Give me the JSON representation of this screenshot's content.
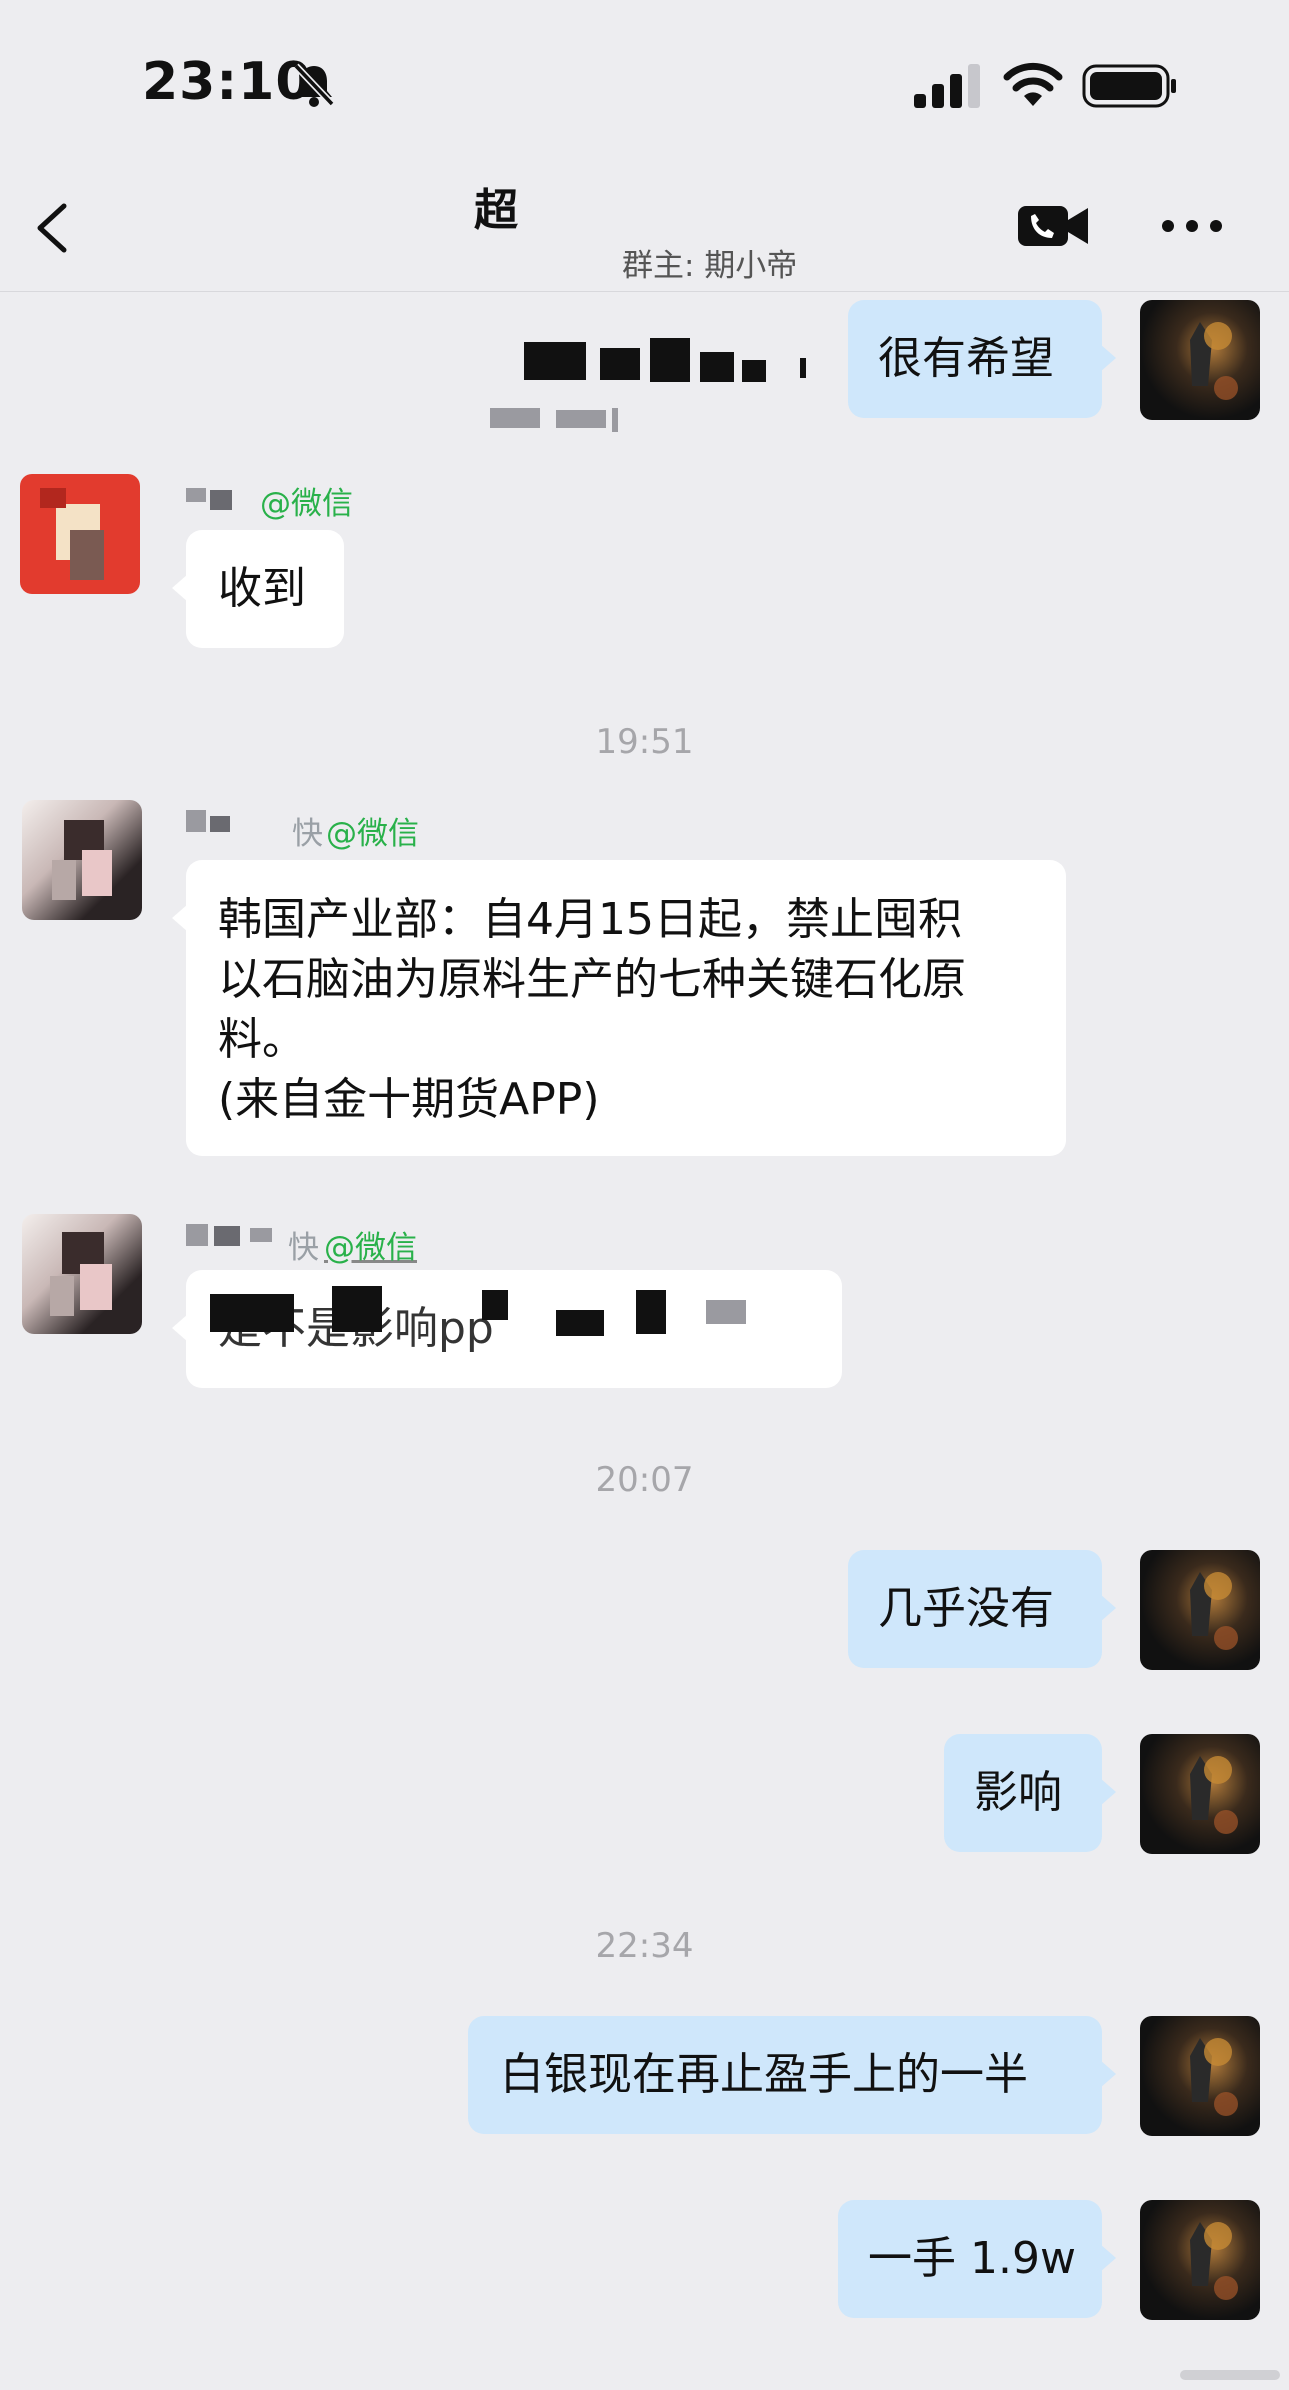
{
  "status_bar": {
    "time": "23:10",
    "icons": [
      "bell-slash-icon",
      "cellular-signal-icon",
      "wifi-icon",
      "battery-icon"
    ]
  },
  "nav": {
    "back_icon": "chevron-left-icon",
    "title": "超",
    "subtitle": "群主: 期小帝",
    "video_call_icon": "video-call-icon",
    "more_icon": "more-icon"
  },
  "messages": [
    {
      "from": "me",
      "text": "很有希望"
    },
    {
      "from": "other",
      "sender_suffix": "@微信",
      "text": "收到"
    },
    {
      "timestamp": "19:51"
    },
    {
      "from": "other",
      "sender_suffix": "@微信",
      "sender_name_part": "快",
      "lines": [
        "韩国产业部：自4月15日起，禁止囤积",
        "以石脑油为原料生产的七种关键石化原",
        "料。",
        "(来自金十期货APP)"
      ]
    },
    {
      "from": "other",
      "sender_suffix": "@微信",
      "sender_name_part": "快",
      "text": "是不是影响pp"
    },
    {
      "timestamp": "20:07"
    },
    {
      "from": "me",
      "text": "几乎没有"
    },
    {
      "from": "me",
      "text": "影响"
    },
    {
      "timestamp": "22:34"
    },
    {
      "from": "me",
      "text": "白银现在再止盈手上的一半"
    },
    {
      "from": "me",
      "text": "一手 1.9w"
    }
  ],
  "colors": {
    "background": "#ededf0",
    "my_bubble": "#cfe7fb",
    "other_bubble": "#ffffff",
    "wechat_tag": "#29b14a"
  }
}
